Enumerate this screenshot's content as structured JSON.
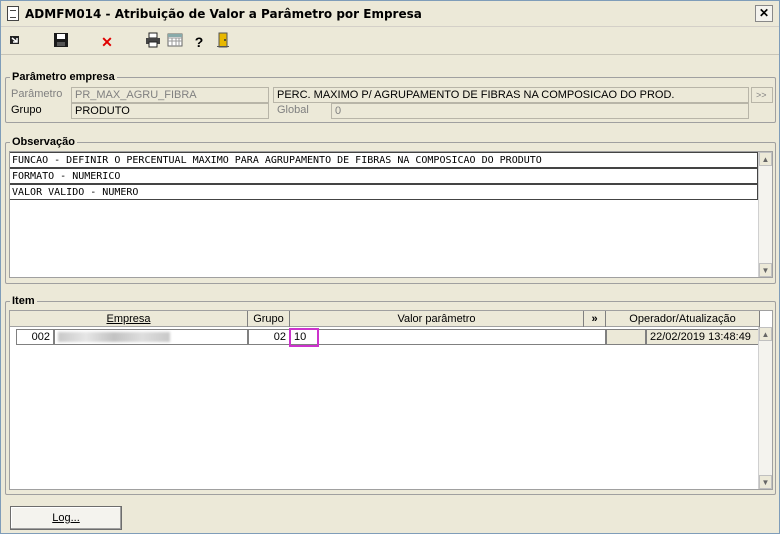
{
  "window": {
    "title": "ADMFM014 - Atribuição de Valor a Parâmetro por Empresa",
    "close_label": "✕"
  },
  "toolbar": {
    "icons": [
      "exit-icon",
      "save-icon",
      "delete-icon",
      "print-icon",
      "calendar-icon",
      "help-icon",
      "door-icon"
    ]
  },
  "parametro_empresa": {
    "legend": "Parâmetro empresa",
    "parametro_label": "Parâmetro",
    "parametro_value": "PR_MAX_AGRU_FIBRA",
    "descricao_value": "PERC. MAXIMO P/ AGRUPAMENTO DE FIBRAS NA COMPOSICAO DO PROD.",
    "grupo_label": "Grupo",
    "grupo_value": "PRODUTO",
    "global_label": "Global",
    "global_value": "0",
    "lookup_label": ">>"
  },
  "observacao": {
    "legend": "Observação",
    "lines": [
      "FUNCAO - DEFINIR O PERCENTUAL MAXIMO PARA AGRUPAMENTO DE FIBRAS NA COMPOSICAO DO PRODUTO",
      "FORMATO - NUMERICO",
      "VALOR VALIDO - NUMERO"
    ]
  },
  "item": {
    "legend": "Item",
    "columns": {
      "empresa": "Empresa",
      "grupo": "Grupo",
      "valor": "Valor parâmetro",
      "expand": "»",
      "operador": "Operador/Atualização"
    },
    "rows": [
      {
        "code": "002",
        "grupo": "02",
        "valor": "10",
        "operador": "",
        "atualizacao": "22/02/2019 13:48:49"
      }
    ]
  },
  "footer": {
    "log_label": "Log..."
  },
  "colors": {
    "highlight": "#cc33cc",
    "background": "#ece9d8"
  }
}
